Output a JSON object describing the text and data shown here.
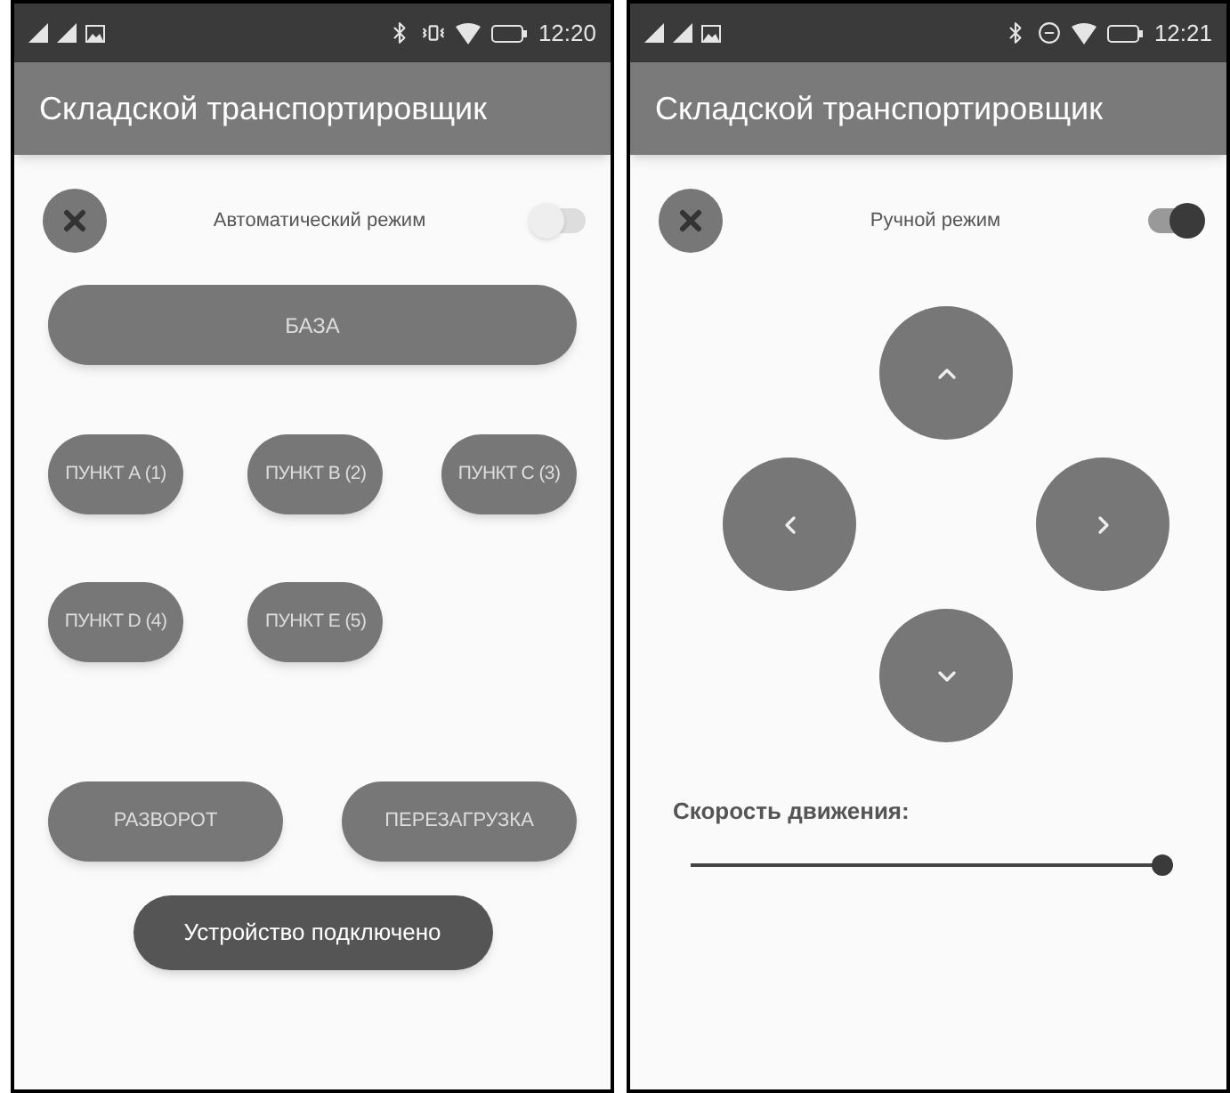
{
  "screens": [
    {
      "kind": "automatic",
      "status_bar": {
        "kind": "vibrate",
        "time": "12:20"
      },
      "app_bar": {
        "title": "Складской транспортировщик"
      },
      "mode_label": "Автоматический режим",
      "mode_switch": {
        "on": false
      },
      "base_button": "БАЗА",
      "point_buttons": [
        "ПУНКТ А (1)",
        "ПУНКТ В (2)",
        "ПУНКТ С (3)",
        "ПУНКТ D (4)",
        "ПУНКТ Е (5)"
      ],
      "action_buttons": [
        "РАЗВОРОТ",
        "ПЕРЕЗАГРУЗКА"
      ],
      "status_button": "Устройство подключено"
    },
    {
      "kind": "manual",
      "status_bar": {
        "kind": "dnd",
        "time": "12:21"
      },
      "app_bar": {
        "title": "Складской транспортировщик"
      },
      "mode_label": "Ручной режим",
      "mode_switch": {
        "on": true
      },
      "speed": {
        "label": "Скорость движения:",
        "level": 1
      }
    }
  ]
}
